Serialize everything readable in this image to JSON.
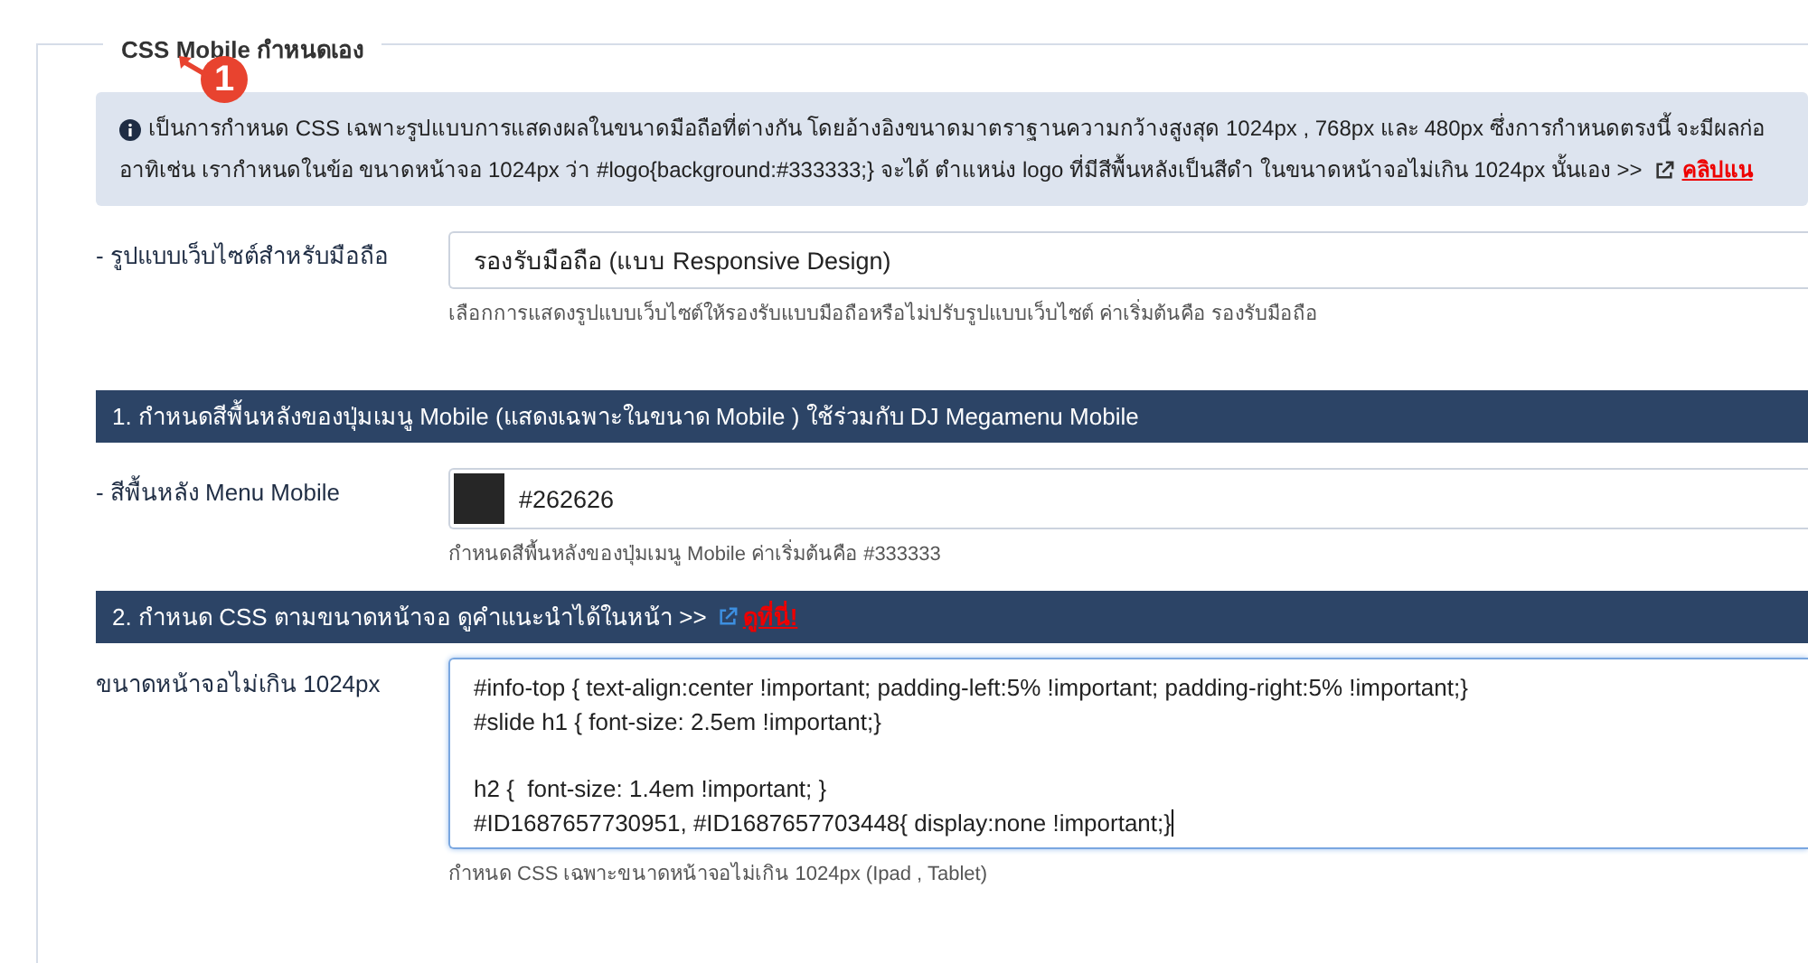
{
  "fieldset": {
    "legend": "CSS Mobile กำหนดเอง",
    "step_badge": "1"
  },
  "info": {
    "lines": [
      "เป็นการกำหนด CSS เฉพาะรูปแบบการแสดงผลในขนาดมือถือที่ต่างกัน โดยอ้างอิงขนาดมาตราฐานความกว้างสูงสุด 1024px , 768px และ 480px ซึ่งการกำหนดตรงนี้ จะมีผลก่อ",
      "อาทิเช่น เรากำหนดในข้อ ขนาดหน้าจอ 1024px ว่า #logo{background:#333333;} จะได้ ตำแหน่ง logo ที่มีสีพื้นหลังเป็นสีดำ ในขนาดหน้าจอไม่เกิน 1024px นั้นเอง >>"
    ],
    "link": "คลิปแน"
  },
  "rows": [
    {
      "kind": "select",
      "label": "- รูปแบบเว็บไซต์สำหรับมือถือ",
      "value": "รองรับมือถือ (แบบ Responsive Design)",
      "help": "เลือกการแสดงรูปแบบเว็บไซต์ให้รองรับแบบมือถือหรือไม่ปรับรูปแบบเว็บไซต์ ค่าเริ่มต้นคือ รองรับมือถือ"
    },
    {
      "kind": "header",
      "title": "1. กำหนดสีพื้นหลังของปุ่มเมนู Mobile (แสดงเฉพาะในขนาด Mobile ) ใช้ร่วมกับ DJ Megamenu Mobile"
    },
    {
      "kind": "color",
      "label": "- สีพื้นหลัง Menu Mobile",
      "value": "#262626",
      "color": "#262626",
      "help": "กำหนดสีพื้นหลังของปุ่มเมนู Mobile ค่าเริ่มต้นคือ #333333"
    },
    {
      "kind": "header",
      "title": "2. กำหนด CSS ตามขนาดหน้าจอ ดูคำแนะนำได้ในหน้า >>",
      "link": "ดูที่นี่!"
    },
    {
      "kind": "code",
      "label": "ขนาดหน้าจอไม่เกิน 1024px",
      "focused": true,
      "blocks": [
        [
          "#info-top { text-align:center !important; padding-left:5% !important; padding-right:5% !important;}",
          "#slide h1 { font-size: 2.5em !important;}"
        ],
        [
          "h2 {  font-size: 1.4em !important; }",
          "#ID1687657730951, #ID1687657703448{ display:none !important;}"
        ]
      ],
      "help": "กำหนด CSS เฉพาะขนาดหน้าจอไม่เกิน 1024px (Ipad , Tablet)"
    }
  ]
}
